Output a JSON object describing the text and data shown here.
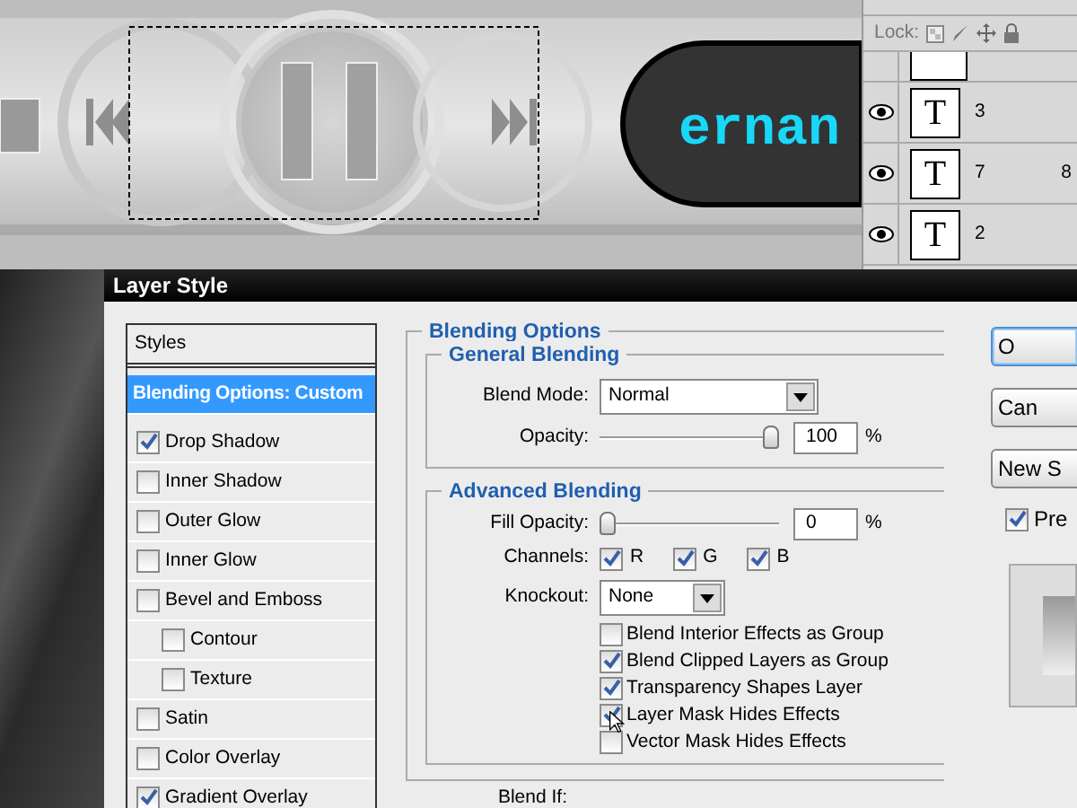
{
  "canvas": {
    "display_text": "ernan"
  },
  "layers_panel": {
    "lock_label": "Lock:",
    "layers": [
      {
        "name": "3",
        "thumb": "T",
        "visible": true
      },
      {
        "name": "7",
        "thumb": "T",
        "visible": true,
        "extra": "8"
      },
      {
        "name": "2",
        "thumb": "T",
        "visible": true
      }
    ]
  },
  "dialog": {
    "title": "Layer Style",
    "styles_list": {
      "header": "Styles",
      "items": [
        {
          "label": "Blending Options: Custom",
          "kind": "heading",
          "selected": true
        },
        {
          "label": "Drop Shadow",
          "kind": "effect",
          "checked": true,
          "selected": false
        },
        {
          "label": "Inner Shadow",
          "kind": "effect",
          "checked": false,
          "selected": false
        },
        {
          "label": "Outer Glow",
          "kind": "effect",
          "checked": false,
          "selected": false
        },
        {
          "label": "Inner Glow",
          "kind": "effect",
          "checked": false,
          "selected": false
        },
        {
          "label": "Bevel and Emboss",
          "kind": "effect",
          "checked": false,
          "selected": false,
          "children": [
            {
              "label": "Contour",
              "kind": "effect",
              "checked": false,
              "selected": false
            },
            {
              "label": "Texture",
              "kind": "effect",
              "checked": false,
              "selected": false
            }
          ]
        },
        {
          "label": "Satin",
          "kind": "effect",
          "checked": false,
          "selected": false
        },
        {
          "label": "Color Overlay",
          "kind": "effect",
          "checked": false,
          "selected": false
        },
        {
          "label": "Gradient Overlay",
          "kind": "effect",
          "checked": true,
          "selected": false
        }
      ]
    },
    "blending_options": {
      "title": "Blending Options",
      "general": {
        "title": "General Blending",
        "blend_mode": {
          "label": "Blend Mode:",
          "value": "Normal"
        },
        "opacity": {
          "label": "Opacity:",
          "level": 1,
          "value": "100",
          "unit": "%"
        }
      },
      "advanced": {
        "title": "Advanced Blending",
        "fill_opacity": {
          "label": "Fill Opacity:",
          "level": 0,
          "value": "0",
          "unit": "%"
        },
        "channels_label": "Channels:",
        "channels": [
          {
            "label": "R",
            "checked": true
          },
          {
            "label": "G",
            "checked": true
          },
          {
            "label": "B",
            "checked": true
          }
        ],
        "knockout": {
          "label": "Knockout:",
          "value": "None"
        },
        "options": [
          {
            "label": "Blend Interior Effects as Group",
            "checked": false
          },
          {
            "label": "Blend Clipped Layers as Group",
            "checked": true
          },
          {
            "label": "Transparency Shapes Layer",
            "checked": true
          },
          {
            "label": "Layer Mask Hides Effects",
            "checked": true
          },
          {
            "label": "Vector Mask Hides Effects",
            "checked": false
          }
        ]
      },
      "blend_if": {
        "label": "Blend If:"
      }
    },
    "buttons": [
      {
        "label": "O",
        "default": true
      },
      {
        "label": "Can",
        "default": false
      },
      {
        "label": "New S",
        "default": false
      }
    ],
    "preview": {
      "label": "Pre",
      "checked": true
    }
  }
}
